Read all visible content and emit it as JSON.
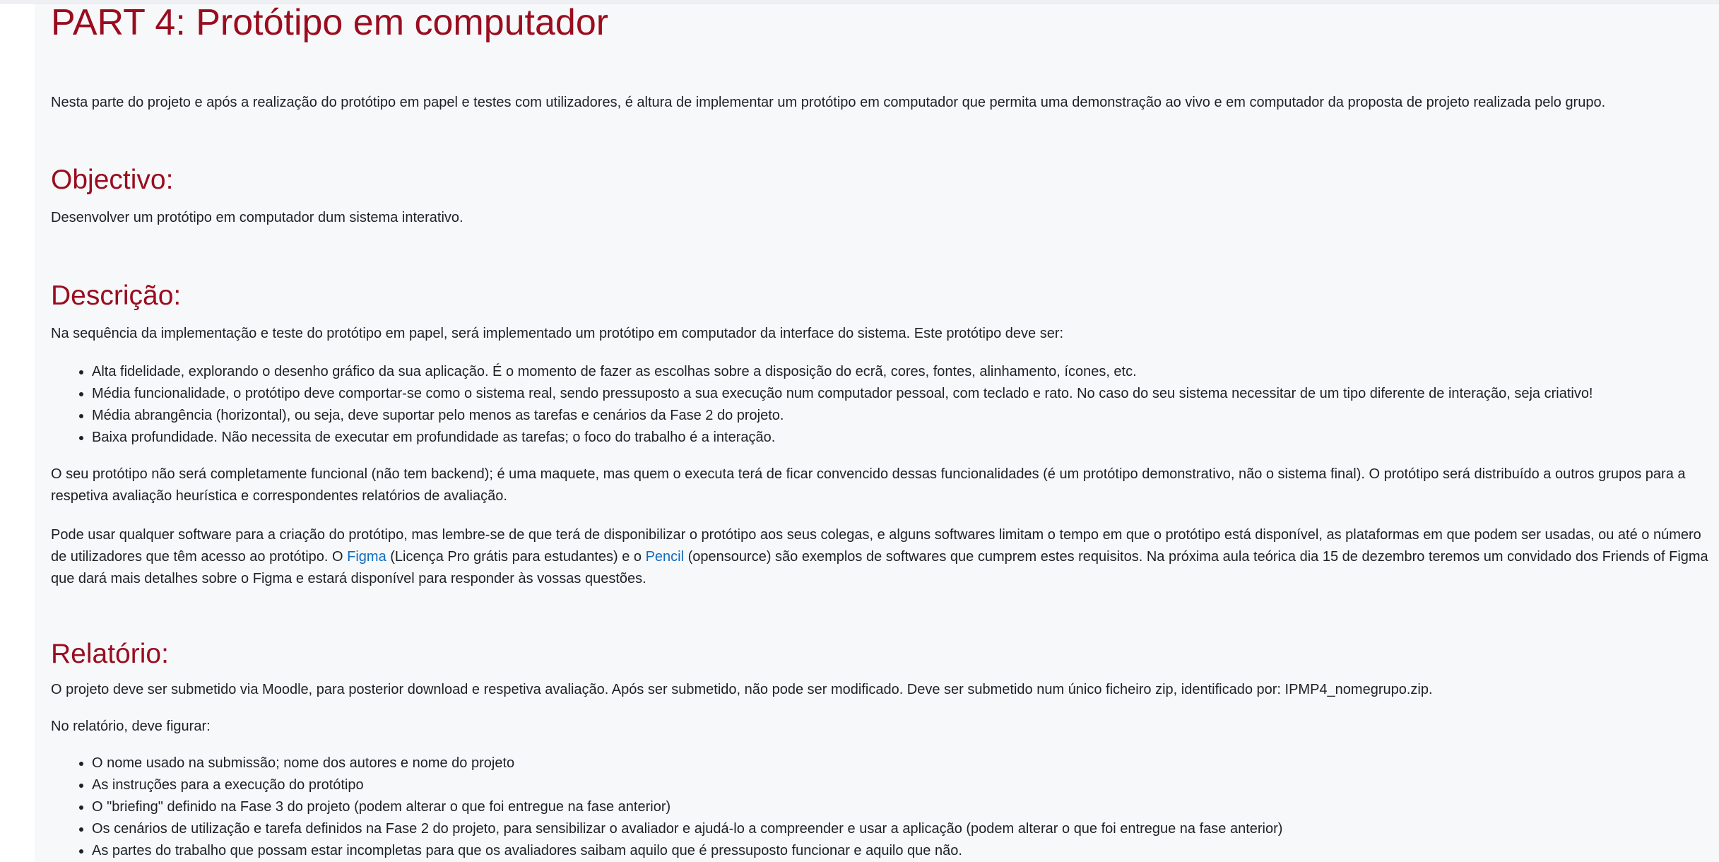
{
  "title": "PART 4: Protótipo em computador",
  "intro": "Nesta parte do projeto e após a realização do protótipo em papel e testes com utilizadores, é altura de implementar um protótipo em computador que permita uma demonstração ao vivo e em computador da proposta de projeto realizada pelo grupo.",
  "objectivo": {
    "heading": "Objectivo:",
    "text": "Desenvolver um protótipo em computador dum sistema interativo."
  },
  "descricao": {
    "heading": "Descrição:",
    "lead": "Na sequência da implementação e teste do protótipo em papel, será implementado um protótipo em computador da interface do sistema. Este protótipo deve ser:",
    "items": [
      "Alta fidelidade, explorando o desenho gráfico da sua aplicação. É o momento de fazer as escolhas sobre a disposição do ecrã, cores, fontes, alinhamento, ícones, etc.",
      "Média funcionalidade, o protótipo deve comportar-se como o sistema real, sendo pressuposto a sua execução num computador pessoal, com teclado e rato. No caso do seu sistema necessitar de um tipo diferente de interação, seja criativo!",
      "Média abrangência (horizontal), ou seja, deve suportar pelo menos as tarefas e cenários da Fase 2 do projeto.",
      "Baixa profundidade. Não necessita de executar em profundidade as tarefas; o foco do trabalho é a interação."
    ],
    "para1": "O seu protótipo não será completamente funcional (não tem backend); é uma maquete, mas quem o executa terá de ficar convencido dessas funcionalidades (é um protótipo demonstrativo, não o sistema final). O protótipo será distribuído a outros grupos para a respetiva avaliação heurística e correspondentes relatórios de avaliação.",
    "para2": {
      "part1": "Pode usar qualquer software para a criação do protótipo, mas lembre-se de que terá de disponibilizar o protótipo aos seus colegas, e alguns softwares limitam o tempo em que o protótipo está disponível, as plataformas em que podem ser usadas, ou até o número de utilizadores que têm acesso ao protótipo. O ",
      "link1": "Figma",
      "part2": " (Licença Pro grátis para estudantes) e o ",
      "link2": "Pencil",
      "part3": " (opensource) são exemplos de softwares que cumprem estes requisitos. Na próxima aula teórica dia 15 de dezembro teremos um convidado dos Friends of Figma que dará mais detalhes sobre o Figma e estará disponível para responder às vossas questões."
    }
  },
  "relatorio": {
    "heading": "Relatório:",
    "text": "O projeto deve ser submetido via Moodle, para posterior download e respetiva avaliação. Após ser submetido, não pode ser modificado. Deve ser submetido num único ficheiro zip, identificado por: IPMP4_nomegrupo.zip.",
    "lead": "No relatório, deve figurar:",
    "items": [
      "O nome usado na submissão; nome dos autores e nome do projeto",
      "As instruções para a execução do protótipo",
      "O \"briefing\" definido na Fase 3 do projeto (podem alterar o que foi entregue na fase anterior)",
      "Os cenários de utilização e tarefa definidos na Fase 2 do projeto, para sensibilizar o avaliador e ajudá-lo a compreender e usar a aplicação (podem alterar o que foi entregue na fase anterior)",
      "As partes do trabalho que possam estar incompletas para que os avaliadores saibam aquilo que é pressuposto funcionar e aquilo que não."
    ]
  },
  "colors": {
    "heading": "#990d1f",
    "link": "#0f6cbf",
    "text": "#1d2125",
    "background": "#f7f8fa"
  }
}
